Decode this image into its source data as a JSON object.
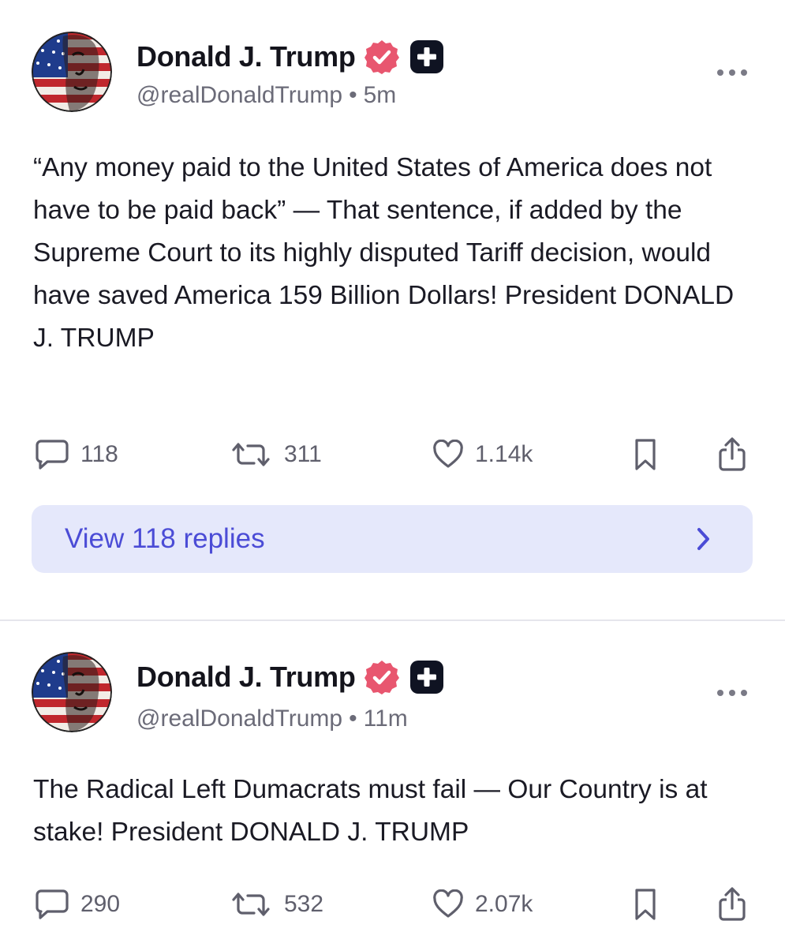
{
  "posts": [
    {
      "author": {
        "name": "Donald J. Trump",
        "handle": "@realDonaldTrump",
        "avatar_icon": "flag-face-avatar",
        "verified_icon": "verified-badge-icon",
        "plus_icon": "plus-badge-icon"
      },
      "time": "5m",
      "separator": "•",
      "text": "“Any money paid to the United States of America does not have to be paid back” — That sentence, if added by the Supreme Court to its highly disputed Tariff decision, would have saved America 159 Billion Dollars! President DONALD J. TRUMP",
      "stats": {
        "replies": "118",
        "reposts": "311",
        "likes": "1.14k"
      },
      "replies_link": "View 118 replies"
    },
    {
      "author": {
        "name": "Donald J. Trump",
        "handle": "@realDonaldTrump",
        "avatar_icon": "flag-face-avatar",
        "verified_icon": "verified-badge-icon",
        "plus_icon": "plus-badge-icon"
      },
      "time": "11m",
      "separator": "•",
      "text": "The Radical Left Dumacrats must fail — Our Country is at stake! President DONALD J. TRUMP",
      "stats": {
        "replies": "290",
        "reposts": "532",
        "likes": "2.07k"
      }
    }
  ],
  "colors": {
    "text": "#1a1a24",
    "muted": "#6b6b78",
    "verified": "#e8566f",
    "accent": "#4b4cd6",
    "replies_bg": "#e5e8fb",
    "divider": "#e6e6ec"
  }
}
